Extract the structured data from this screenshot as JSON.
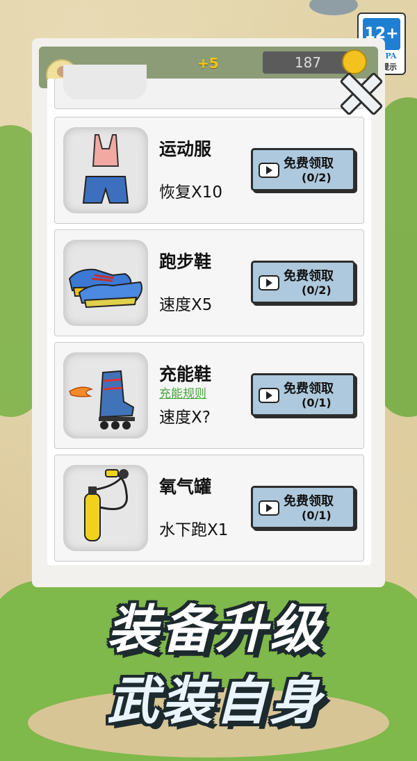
{
  "age_badge": {
    "rating": "12+",
    "org": "CADPA",
    "label": "适龄提示"
  },
  "topbar": {
    "bonus": "+5",
    "coins": "187"
  },
  "items": [
    {
      "name": "运动服",
      "rule": "",
      "effect": "恢复X10",
      "claim_label": "免费领取",
      "claim_count": "(0/2)",
      "icon": "sportswear-icon"
    },
    {
      "name": "跑步鞋",
      "rule": "",
      "effect": "速度X5",
      "claim_label": "免费领取",
      "claim_count": "(0/2)",
      "icon": "running-shoes-icon"
    },
    {
      "name": "充能鞋",
      "rule": "充能规则",
      "effect": "速度X?",
      "claim_label": "免费领取",
      "claim_count": "(0/1)",
      "icon": "charged-roller-skate-icon"
    },
    {
      "name": "氧气罐",
      "rule": "",
      "effect": "水下跑X1",
      "claim_label": "免费领取",
      "claim_count": "(0/1)",
      "icon": "oxygen-tank-icon"
    }
  ],
  "banner": {
    "line1": "装备升级",
    "line2": "武装自身"
  }
}
